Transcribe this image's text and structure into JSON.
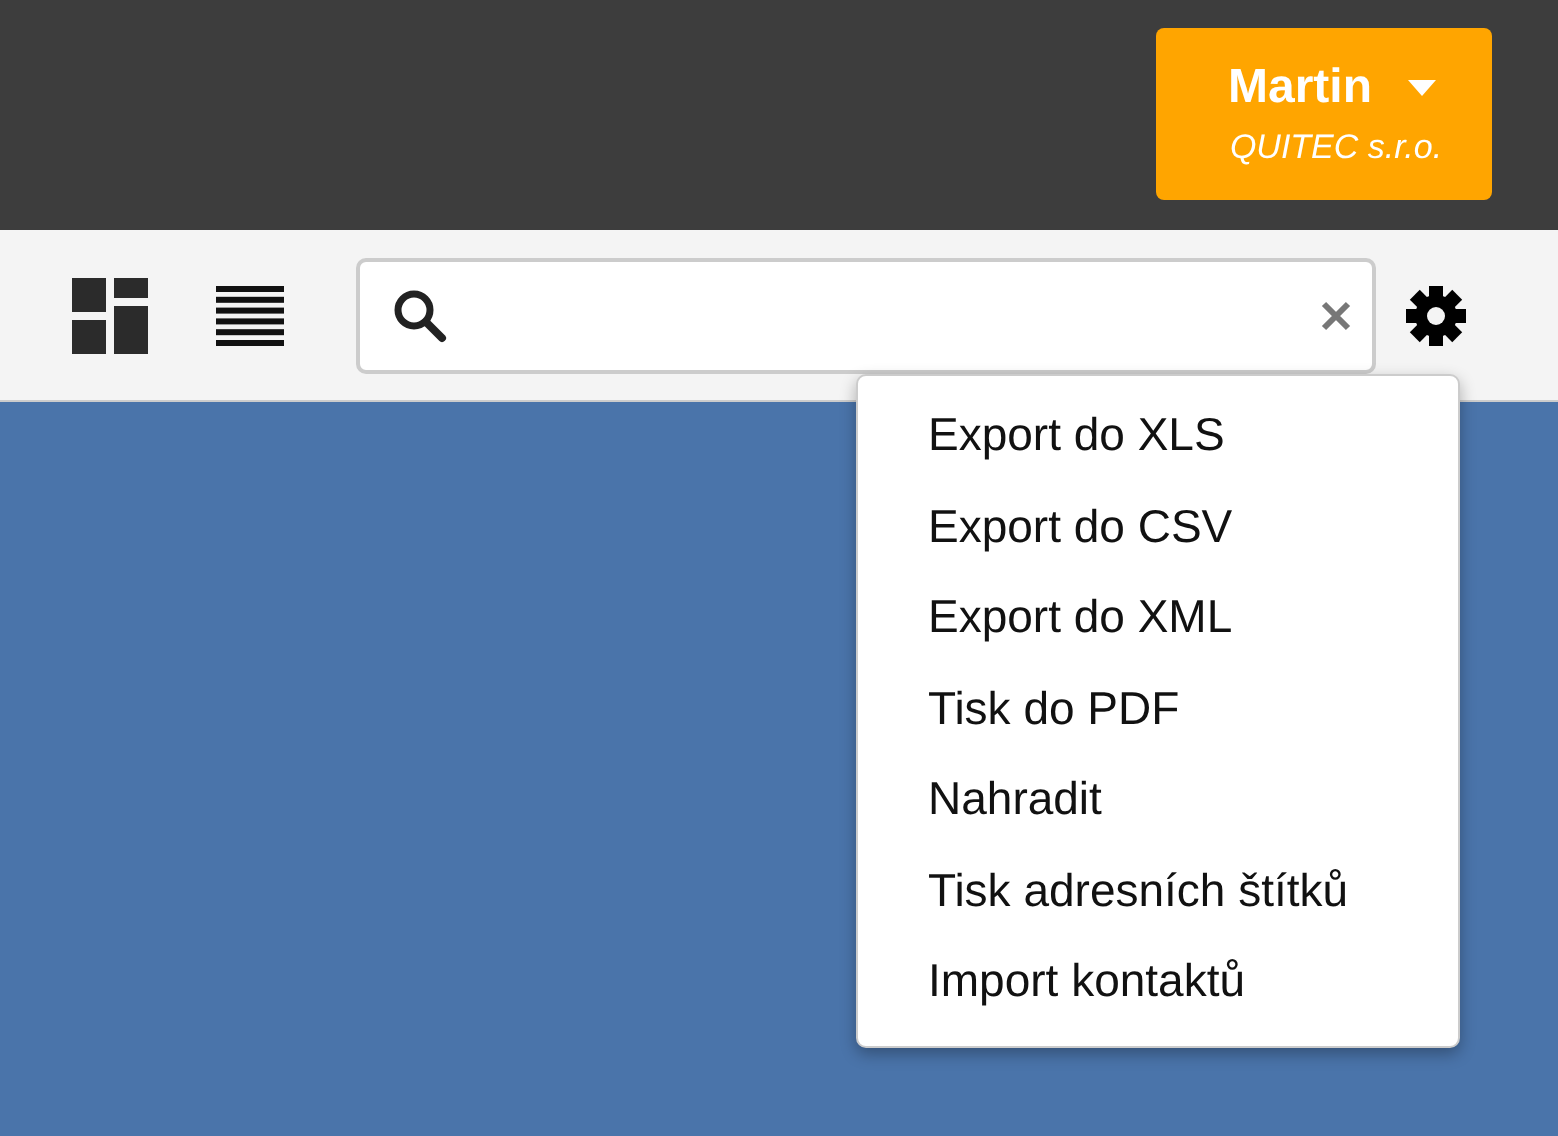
{
  "user": {
    "name": "Martin",
    "company": "QUITEC s.r.o."
  },
  "menu": {
    "items": [
      {
        "label": "Export do XLS"
      },
      {
        "label": "Export do CSV"
      },
      {
        "label": "Export do XML"
      },
      {
        "label": "Tisk do PDF"
      },
      {
        "label": "Nahradit"
      },
      {
        "label": "Tisk adresních štítků"
      },
      {
        "label": "Import kontaktů"
      }
    ]
  }
}
